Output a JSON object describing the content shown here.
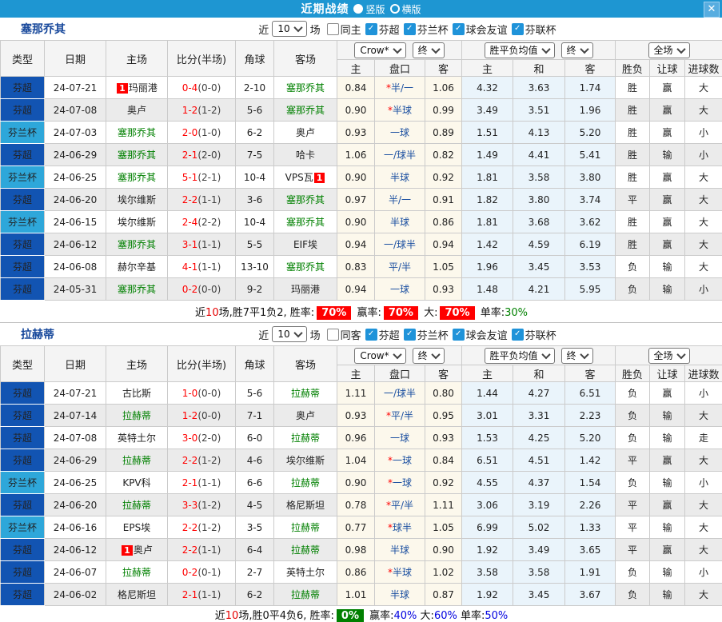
{
  "title_bar": {
    "title": "近期战绩",
    "vertical_label": "竖版",
    "horizontal_label": "横版",
    "close_label": "✕"
  },
  "colors": {
    "accent_bar": "#1E96D2",
    "league_type_colors": {
      "芬超": "#1254B2",
      "芬兰杯": "#2EA7DA"
    },
    "crow_block_bg": "#FCF8EC",
    "avg_block_bg": "#EAF4FB",
    "win": "#E60000",
    "draw": "#0000E0",
    "lose": "#008000"
  },
  "table_header": {
    "main": [
      "类型",
      "日期",
      "主场",
      "比分(半场)",
      "角球",
      "客场"
    ],
    "groups": {
      "odds_company": "Crow*",
      "odds_stage": "终",
      "avg": "胜平负均值",
      "avg_stage": "终",
      "scope": "全场"
    },
    "sub": [
      "主",
      "盘口",
      "客",
      "主",
      "和",
      "客",
      "胜负",
      "让球",
      "进球数"
    ]
  },
  "filter_labels": {
    "near": "近",
    "count": "10",
    "games": "场"
  },
  "sections": [
    {
      "team": "塞那乔其",
      "same_label": "同主",
      "same_checked": false,
      "leagues": [
        "芬超",
        "芬兰杯",
        "球会友谊",
        "芬联杯"
      ],
      "rows": [
        {
          "ty": "芬超",
          "dt": "24-07-21",
          "hm": "[1]玛丽港",
          "sf": "0-4",
          "sh": "0-0",
          "cn": "2-10",
          "aw": "塞那乔其",
          "o1": "0.84",
          "hc": "*半/一",
          "o2": "1.06",
          "a1": "4.32",
          "a2": "3.63",
          "a3": "1.74",
          "r1": "胜",
          "r2": "赢",
          "r3": "大"
        },
        {
          "ty": "芬超",
          "dt": "24-07-08",
          "hm": "奥卢",
          "sf": "1-2",
          "sh": "1-2",
          "cn": "5-6",
          "aw": "塞那乔其",
          "o1": "0.90",
          "hc": "*半球",
          "o2": "0.99",
          "a1": "3.49",
          "a2": "3.51",
          "a3": "1.96",
          "r1": "胜",
          "r2": "赢",
          "r3": "大"
        },
        {
          "ty": "芬兰杯",
          "dt": "24-07-03",
          "hm": "塞那乔其",
          "sf": "2-0",
          "sh": "1-0",
          "cn": "6-2",
          "aw": "奥卢",
          "o1": "0.93",
          "hc": "一球",
          "o2": "0.89",
          "a1": "1.51",
          "a2": "4.13",
          "a3": "5.20",
          "r1": "胜",
          "r2": "赢",
          "r3": "小"
        },
        {
          "ty": "芬超",
          "dt": "24-06-29",
          "hm": "塞那乔其",
          "sf": "2-1",
          "sh": "2-0",
          "cn": "7-5",
          "aw": "哈卡",
          "o1": "1.06",
          "hc": "一/球半",
          "o2": "0.82",
          "a1": "1.49",
          "a2": "4.41",
          "a3": "5.41",
          "r1": "胜",
          "r2": "输",
          "r3": "小"
        },
        {
          "ty": "芬兰杯",
          "dt": "24-06-25",
          "hm": "塞那乔其",
          "sf": "5-1",
          "sh": "2-1",
          "cn": "10-4",
          "aw": "VPS瓦[1]",
          "o1": "0.90",
          "hc": "半球",
          "o2": "0.92",
          "a1": "1.81",
          "a2": "3.58",
          "a3": "3.80",
          "r1": "胜",
          "r2": "赢",
          "r3": "大"
        },
        {
          "ty": "芬超",
          "dt": "24-06-20",
          "hm": "埃尔维斯",
          "sf": "2-2",
          "sh": "1-1",
          "cn": "3-6",
          "aw": "塞那乔其",
          "o1": "0.97",
          "hc": "半/一",
          "o2": "0.91",
          "a1": "1.82",
          "a2": "3.80",
          "a3": "3.74",
          "r1": "平",
          "r2": "赢",
          "r3": "大"
        },
        {
          "ty": "芬兰杯",
          "dt": "24-06-15",
          "hm": "埃尔维斯",
          "sf": "2-4",
          "sh": "2-2",
          "cn": "10-4",
          "aw": "塞那乔其",
          "o1": "0.90",
          "hc": "半球",
          "o2": "0.86",
          "a1": "1.81",
          "a2": "3.68",
          "a3": "3.62",
          "r1": "胜",
          "r2": "赢",
          "r3": "大"
        },
        {
          "ty": "芬超",
          "dt": "24-06-12",
          "hm": "塞那乔其",
          "sf": "3-1",
          "sh": "1-1",
          "cn": "5-5",
          "aw": "EIF埃",
          "o1": "0.94",
          "hc": "一/球半",
          "o2": "0.94",
          "a1": "1.42",
          "a2": "4.59",
          "a3": "6.19",
          "r1": "胜",
          "r2": "赢",
          "r3": "大"
        },
        {
          "ty": "芬超",
          "dt": "24-06-08",
          "hm": "赫尔辛基",
          "sf": "4-1",
          "sh": "1-1",
          "cn": "13-10",
          "aw": "塞那乔其",
          "o1": "0.83",
          "hc": "平/半",
          "o2": "1.05",
          "a1": "1.96",
          "a2": "3.45",
          "a3": "3.53",
          "r1": "负",
          "r2": "输",
          "r3": "大"
        },
        {
          "ty": "芬超",
          "dt": "24-05-31",
          "hm": "塞那乔其",
          "sf": "0-2",
          "sh": "0-0",
          "cn": "9-2",
          "aw": "玛丽港",
          "o1": "0.94",
          "hc": "一球",
          "o2": "0.93",
          "a1": "1.48",
          "a2": "4.21",
          "a3": "5.95",
          "r1": "负",
          "r2": "输",
          "r3": "小"
        }
      ],
      "summary": [
        {
          "t": "近"
        },
        {
          "t": "10",
          "c": "red"
        },
        {
          "t": "场,胜7平1负2, 胜率:"
        },
        {
          "t": "70%",
          "badge": "red"
        },
        {
          "t": " 赢率:"
        },
        {
          "t": "70%",
          "badge": "red"
        },
        {
          "t": " 大:"
        },
        {
          "t": "70%",
          "badge": "red"
        },
        {
          "t": " 单率:"
        },
        {
          "t": "30%",
          "c": "green"
        }
      ]
    },
    {
      "team": "拉赫蒂",
      "same_label": "同客",
      "same_checked": false,
      "leagues": [
        "芬超",
        "芬兰杯",
        "球会友谊",
        "芬联杯"
      ],
      "rows": [
        {
          "ty": "芬超",
          "dt": "24-07-21",
          "hm": "古比斯",
          "sf": "1-0",
          "sh": "0-0",
          "cn": "5-6",
          "aw": "拉赫蒂",
          "o1": "1.11",
          "hc": "一/球半",
          "o2": "0.80",
          "a1": "1.44",
          "a2": "4.27",
          "a3": "6.51",
          "r1": "负",
          "r2": "赢",
          "r3": "小"
        },
        {
          "ty": "芬超",
          "dt": "24-07-14",
          "hm": "拉赫蒂",
          "sf": "1-2",
          "sh": "0-0",
          "cn": "7-1",
          "aw": "奥卢",
          "o1": "0.93",
          "hc": "*平/半",
          "o2": "0.95",
          "a1": "3.01",
          "a2": "3.31",
          "a3": "2.23",
          "r1": "负",
          "r2": "输",
          "r3": "大"
        },
        {
          "ty": "芬超",
          "dt": "24-07-08",
          "hm": "英特土尔",
          "sf": "3-0",
          "sh": "2-0",
          "cn": "6-0",
          "aw": "拉赫蒂",
          "o1": "0.96",
          "hc": "一球",
          "o2": "0.93",
          "a1": "1.53",
          "a2": "4.25",
          "a3": "5.20",
          "r1": "负",
          "r2": "输",
          "r3": "走"
        },
        {
          "ty": "芬超",
          "dt": "24-06-29",
          "hm": "拉赫蒂",
          "sf": "2-2",
          "sh": "1-2",
          "cn": "4-6",
          "aw": "埃尔维斯",
          "o1": "1.04",
          "hc": "*一球",
          "o2": "0.84",
          "a1": "6.51",
          "a2": "4.51",
          "a3": "1.42",
          "r1": "平",
          "r2": "赢",
          "r3": "大"
        },
        {
          "ty": "芬兰杯",
          "dt": "24-06-25",
          "hm": "KPV科",
          "sf": "2-1",
          "sh": "1-1",
          "cn": "6-6",
          "aw": "拉赫蒂",
          "o1": "0.90",
          "hc": "*一球",
          "o2": "0.92",
          "a1": "4.55",
          "a2": "4.37",
          "a3": "1.54",
          "r1": "负",
          "r2": "输",
          "r3": "小"
        },
        {
          "ty": "芬超",
          "dt": "24-06-20",
          "hm": "拉赫蒂",
          "sf": "3-3",
          "sh": "1-2",
          "cn": "4-5",
          "aw": "格尼斯坦",
          "o1": "0.78",
          "hc": "*平/半",
          "o2": "1.11",
          "a1": "3.06",
          "a2": "3.19",
          "a3": "2.26",
          "r1": "平",
          "r2": "赢",
          "r3": "大"
        },
        {
          "ty": "芬兰杯",
          "dt": "24-06-16",
          "hm": "EPS埃",
          "sf": "2-2",
          "sh": "1-2",
          "cn": "3-5",
          "aw": "拉赫蒂",
          "o1": "0.77",
          "hc": "*球半",
          "o2": "1.05",
          "a1": "6.99",
          "a2": "5.02",
          "a3": "1.33",
          "r1": "平",
          "r2": "输",
          "r3": "大"
        },
        {
          "ty": "芬超",
          "dt": "24-06-12",
          "hm": "[1]奥卢",
          "sf": "2-2",
          "sh": "1-1",
          "cn": "6-4",
          "aw": "拉赫蒂",
          "o1": "0.98",
          "hc": "半球",
          "o2": "0.90",
          "a1": "1.92",
          "a2": "3.49",
          "a3": "3.65",
          "r1": "平",
          "r2": "赢",
          "r3": "大"
        },
        {
          "ty": "芬超",
          "dt": "24-06-07",
          "hm": "拉赫蒂",
          "sf": "0-2",
          "sh": "0-1",
          "cn": "2-7",
          "aw": "英特土尔",
          "o1": "0.86",
          "hc": "*半球",
          "o2": "1.02",
          "a1": "3.58",
          "a2": "3.58",
          "a3": "1.91",
          "r1": "负",
          "r2": "输",
          "r3": "小"
        },
        {
          "ty": "芬超",
          "dt": "24-06-02",
          "hm": "格尼斯坦",
          "sf": "2-1",
          "sh": "1-1",
          "cn": "6-2",
          "aw": "拉赫蒂",
          "o1": "1.01",
          "hc": "半球",
          "o2": "0.87",
          "a1": "1.92",
          "a2": "3.45",
          "a3": "3.67",
          "r1": "负",
          "r2": "输",
          "r3": "大"
        }
      ],
      "summary": [
        {
          "t": "近"
        },
        {
          "t": "10",
          "c": "red"
        },
        {
          "t": "场,胜0平4负6, 胜率:"
        },
        {
          "t": "0%",
          "badge": "green"
        },
        {
          "t": " 赢率:"
        },
        {
          "t": "40%",
          "c": "blue"
        },
        {
          "t": " 大:"
        },
        {
          "t": "60%",
          "c": "blue"
        },
        {
          "t": " 单率:"
        },
        {
          "t": "50%",
          "c": "blue"
        }
      ]
    }
  ]
}
